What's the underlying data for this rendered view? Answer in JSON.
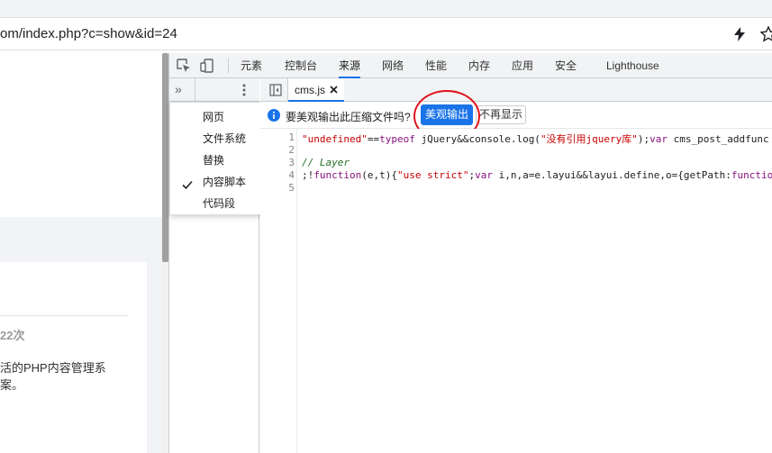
{
  "browser": {
    "url_text": "om/index.php?c=show&id=24",
    "icons": {
      "lightning": "lightning-icon",
      "bookmark": "star-icon"
    }
  },
  "page": {
    "count_text": "22次",
    "desc_line1": "活的PHP内容管理系",
    "desc_line2": "案。"
  },
  "devtools": {
    "tabs": [
      {
        "label": "元素"
      },
      {
        "label": "控制台"
      },
      {
        "label": "来源"
      },
      {
        "label": "网络"
      },
      {
        "label": "性能"
      },
      {
        "label": "内存"
      },
      {
        "label": "应用"
      },
      {
        "label": "安全"
      },
      {
        "label": "Lighthouse"
      }
    ],
    "active_tab": "来源",
    "more_tabs_glyph": "»",
    "navigator_menu": [
      {
        "label": "网页"
      },
      {
        "label": "文件系统"
      },
      {
        "label": "替换"
      },
      {
        "label": "内容脚本"
      },
      {
        "label": "代码段"
      }
    ],
    "checked_item": "内容脚本",
    "file_tab": "cms.js",
    "infobar": {
      "message": "要美观输出此压缩文件吗?",
      "primary_button": "美观输出",
      "secondary_button": "不再显示"
    },
    "code": {
      "line_numbers": [
        "1",
        "2",
        "3",
        "4",
        "5"
      ],
      "l1_s1": "\"undefined\"",
      "l1_p1": "==",
      "l1_k1": "typeof",
      "l1_p2": " jQuery&&console.log(",
      "l1_s2": "\"没有引用jquery库\"",
      "l1_p3": ");",
      "l1_k2": "var",
      "l1_p4": " cms_post_addfunc",
      "l3_comment": "// Layer",
      "l4_p1": ";!",
      "l4_k1": "function",
      "l4_p2": "(e,t){",
      "l4_s1": "\"use strict\"",
      "l4_p3": ";",
      "l4_k2": "var",
      "l4_p4": " i,n,a=e.layui&&layui.define,o={getPath:",
      "l4_k3": "function"
    },
    "colors": {
      "accent": "#1a73e8",
      "highlight": "#e0111b"
    }
  }
}
